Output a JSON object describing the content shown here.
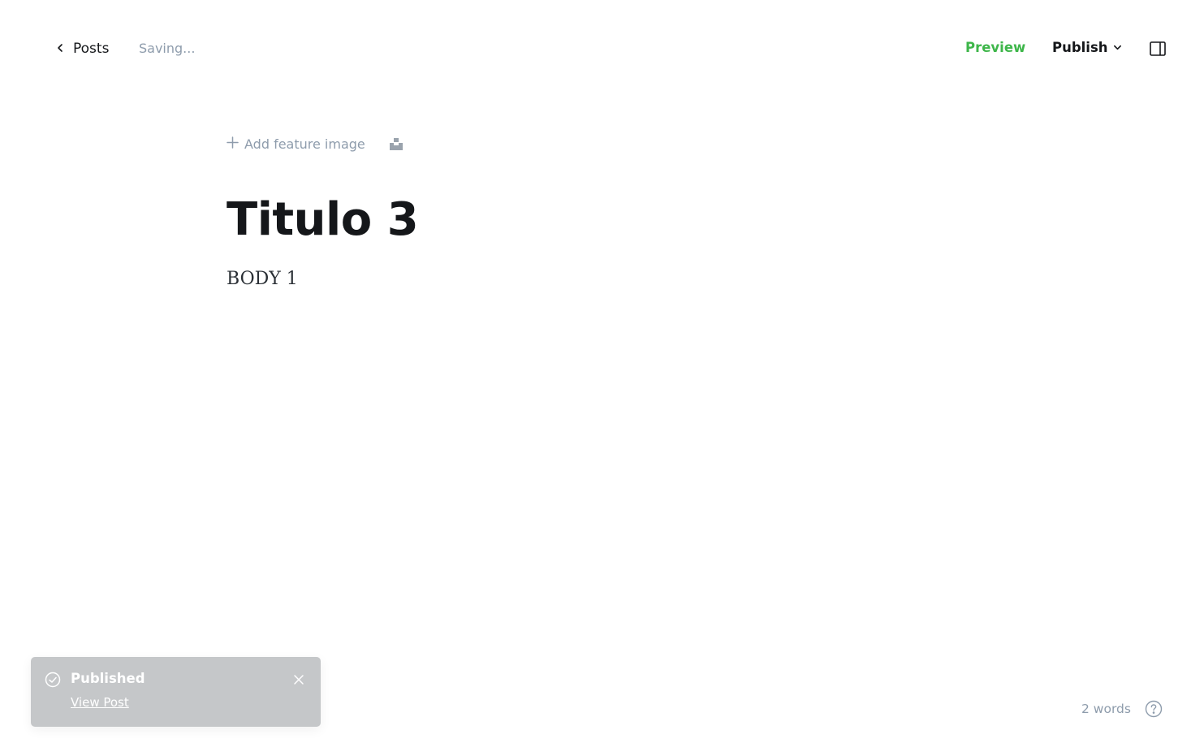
{
  "header": {
    "back_label": "Posts",
    "status": "Saving...",
    "preview_label": "Preview",
    "publish_label": "Publish"
  },
  "editor": {
    "add_feature_image_label": "Add feature image",
    "title": "Titulo 3",
    "body": "BODY 1"
  },
  "toast": {
    "title": "Published",
    "link_label": "View Post"
  },
  "footer": {
    "word_count": "2 words"
  },
  "icons": {
    "back": "chevron-left-icon",
    "publish_menu": "chevron-down-icon",
    "sidebar": "sidebar-toggle-icon",
    "add": "plus-icon",
    "unsplash": "unsplash-icon",
    "toast_status": "check-circle-icon",
    "toast_close": "close-icon",
    "help": "help-icon"
  },
  "colors": {
    "accent_green": "#3eb64a",
    "muted_text": "#8e9cac",
    "primary_text": "#15171a",
    "toast_bg": "#c5c7c9"
  }
}
